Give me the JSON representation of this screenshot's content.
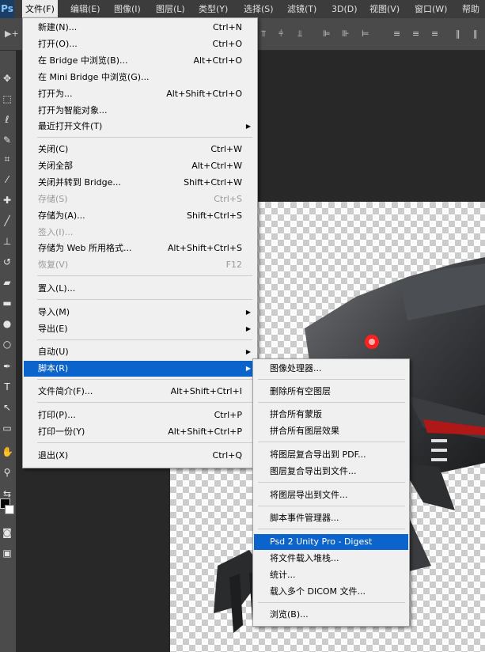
{
  "app": {
    "logo": "Ps"
  },
  "menubar": {
    "items": [
      {
        "label": "文件(F)"
      },
      {
        "label": "编辑(E)"
      },
      {
        "label": "图像(I)"
      },
      {
        "label": "图层(L)"
      },
      {
        "label": "类型(Y)"
      },
      {
        "label": "选择(S)"
      },
      {
        "label": "滤镜(T)"
      },
      {
        "label": "3D(D)"
      },
      {
        "label": "视图(V)"
      },
      {
        "label": "窗口(W)"
      },
      {
        "label": "帮助"
      }
    ]
  },
  "file_menu": {
    "items": [
      {
        "label": "新建(N)...",
        "shortcut": "Ctrl+N"
      },
      {
        "label": "打开(O)...",
        "shortcut": "Ctrl+O"
      },
      {
        "label": "在 Bridge 中浏览(B)...",
        "shortcut": "Alt+Ctrl+O"
      },
      {
        "label": "在 Mini Bridge 中浏览(G)...",
        "shortcut": ""
      },
      {
        "label": "打开为...",
        "shortcut": "Alt+Shift+Ctrl+O"
      },
      {
        "label": "打开为智能对象...",
        "shortcut": ""
      },
      {
        "label": "最近打开文件(T)",
        "shortcut": ""
      },
      {
        "label": "关闭(C)",
        "shortcut": "Ctrl+W"
      },
      {
        "label": "关闭全部",
        "shortcut": "Alt+Ctrl+W"
      },
      {
        "label": "关闭并转到 Bridge...",
        "shortcut": "Shift+Ctrl+W"
      },
      {
        "label": "存储(S)",
        "shortcut": "Ctrl+S"
      },
      {
        "label": "存储为(A)...",
        "shortcut": "Shift+Ctrl+S"
      },
      {
        "label": "签入(I)...",
        "shortcut": ""
      },
      {
        "label": "存储为 Web 所用格式...",
        "shortcut": "Alt+Shift+Ctrl+S"
      },
      {
        "label": "恢复(V)",
        "shortcut": "F12"
      },
      {
        "label": "置入(L)...",
        "shortcut": ""
      },
      {
        "label": "导入(M)",
        "shortcut": ""
      },
      {
        "label": "导出(E)",
        "shortcut": ""
      },
      {
        "label": "自动(U)",
        "shortcut": ""
      },
      {
        "label": "脚本(R)",
        "shortcut": ""
      },
      {
        "label": "文件简介(F)...",
        "shortcut": "Alt+Shift+Ctrl+I"
      },
      {
        "label": "打印(P)...",
        "shortcut": "Ctrl+P"
      },
      {
        "label": "打印一份(Y)",
        "shortcut": "Alt+Shift+Ctrl+P"
      },
      {
        "label": "退出(X)",
        "shortcut": "Ctrl+Q"
      }
    ]
  },
  "scripts_submenu": {
    "items": [
      {
        "label": "图像处理器..."
      },
      {
        "label": "删除所有空图层"
      },
      {
        "label": "拼合所有蒙版"
      },
      {
        "label": "拼合所有图层效果"
      },
      {
        "label": "将图层复合导出到 PDF..."
      },
      {
        "label": "图层复合导出到文件..."
      },
      {
        "label": "将图层导出到文件..."
      },
      {
        "label": "脚本事件管理器..."
      },
      {
        "label": "Psd 2 Unity Pro - Digest"
      },
      {
        "label": "将文件载入堆栈..."
      },
      {
        "label": "统计..."
      },
      {
        "label": "载入多个 DICOM 文件..."
      },
      {
        "label": "浏览(B)..."
      }
    ]
  },
  "colors": {
    "highlight": "#0a64cc",
    "menu_bg": "#f0f0f0",
    "menubar_bg": "#3c3c3c",
    "robot_eye": "#ff2020"
  }
}
